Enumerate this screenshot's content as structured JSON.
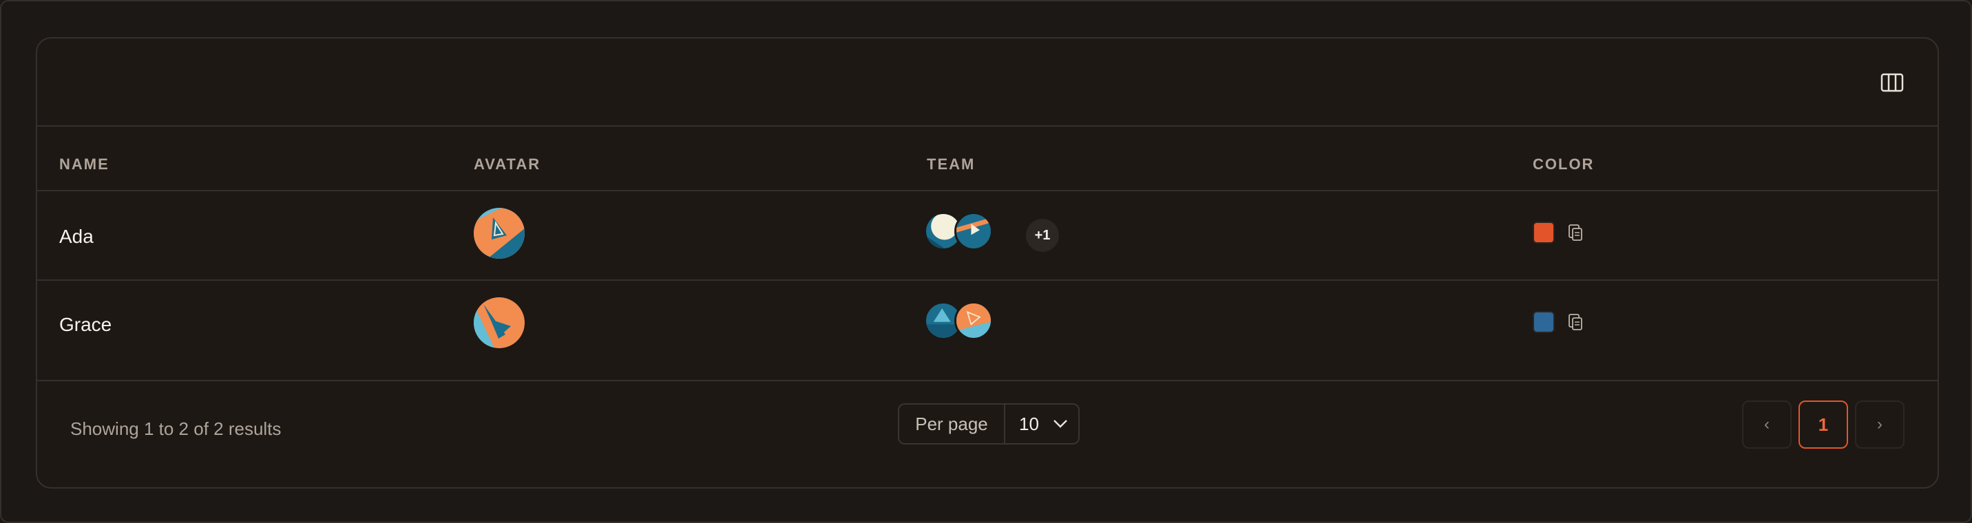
{
  "table": {
    "headers": [
      "NAME",
      "AVATAR",
      "TEAM",
      "COLOR"
    ],
    "rows": [
      {
        "name": "Ada",
        "team_more": "+1",
        "color": "#e4542a"
      },
      {
        "name": "Grace",
        "color": "#2e6898"
      }
    ]
  },
  "footer": {
    "results_text": "Showing 1 to 2 of 2 results",
    "per_page_label": "Per page",
    "per_page_value": "10",
    "prev_label": "‹",
    "current_page": "1",
    "next_label": "›"
  },
  "colors": {
    "accent": "#e4562a",
    "background": "#1c1815",
    "border": "#35302b",
    "avatar_orange": "#f28c4f",
    "avatar_teal": "#1b6e8e",
    "avatar_cyan": "#63bdd6"
  },
  "icons": {
    "columns": "columns-toggle-icon",
    "copy": "copy-icon",
    "chevron": "chevron-down-icon"
  }
}
